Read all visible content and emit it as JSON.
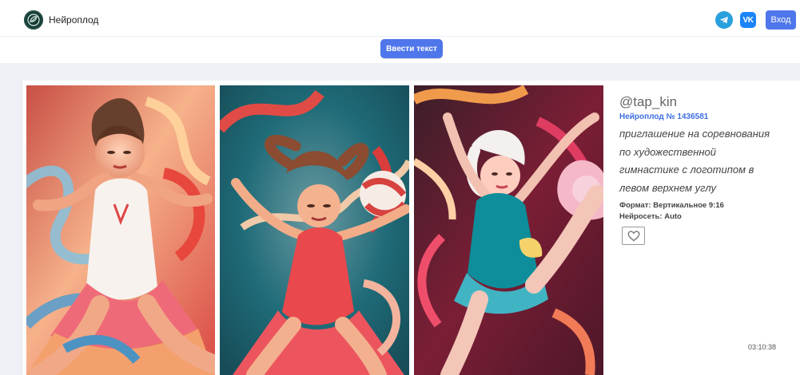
{
  "header": {
    "brand_name": "Нейроплод",
    "logo_icon": "leaf-circle-icon",
    "social_icons": [
      "telegram-icon",
      "vk-icon"
    ],
    "vk_text": "VK",
    "login_label": "Вход"
  },
  "input_strip": {
    "text_button_label": "Ввести текст"
  },
  "post": {
    "username": "@tap_kin",
    "post_id": "Нейроплод № 1436581",
    "prompt": "приглашение на соревнования\nпо художественной\nгимнастике с логотипом в\nлевом верхнем углу",
    "format": "Формат: Вертикальное 9:16",
    "network": "Нейросеть: Auto",
    "time": "03:10:38",
    "like_icon": "heart-outline-icon",
    "artwork_icons": [
      "gymnast-artwork-1-icon",
      "gymnast-artwork-2-icon",
      "gymnast-artwork-3-icon"
    ]
  },
  "colors": {
    "accent": "#4f76eb",
    "link": "#3d6fe0",
    "telegram": "#2aa0dd",
    "vk": "#1b84f6",
    "page_background": "#edf0f4"
  }
}
